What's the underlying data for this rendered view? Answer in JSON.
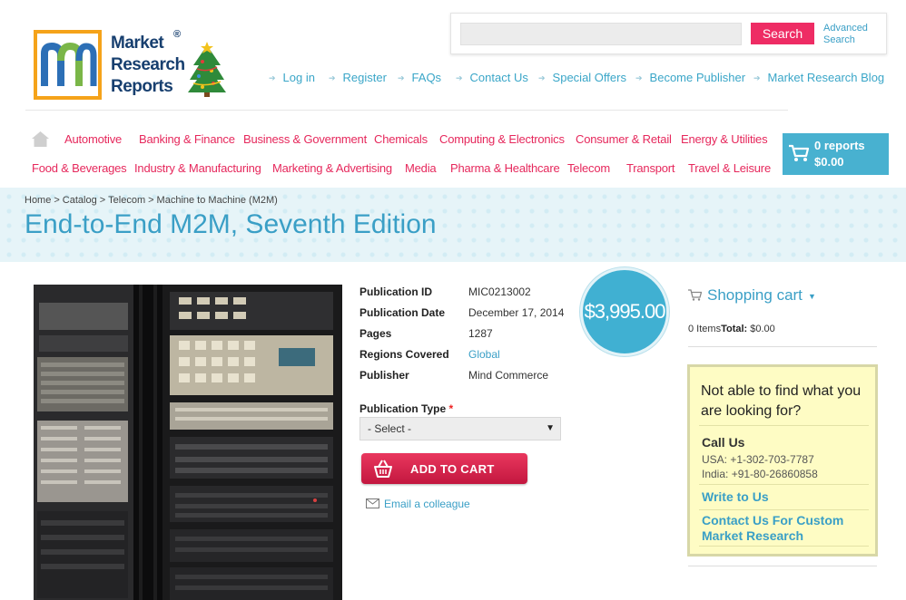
{
  "logo": {
    "line1": "Market",
    "line2": "Research",
    "line3": "Reports",
    "reg": "®",
    "mark": "m"
  },
  "search": {
    "placeholder": "",
    "button_label": "Search",
    "advanced_line1": "Advanced",
    "advanced_line2": "Search"
  },
  "top_links": [
    "Log in",
    "Register",
    "FAQs",
    "Contact Us",
    "Special Offers",
    "Become Publisher",
    "Market Research Blog"
  ],
  "categories_row1": [
    "Automotive",
    "Banking & Finance",
    "Business & Government",
    "Chemicals",
    "Computing & Electronics",
    "Consumer & Retail",
    "Energy & Utilities"
  ],
  "categories_row2": [
    "Food & Beverages",
    "Industry & Manufacturing",
    "Marketing & Advertising",
    "Media",
    "Pharma & Healthcare",
    "Telecom",
    "Transport",
    "Travel & Leisure"
  ],
  "cart": {
    "reports": "0 reports",
    "amount": "$0.00"
  },
  "breadcrumb": [
    "Home",
    "Catalog",
    "Telecom",
    "Machine to Machine (M2M)"
  ],
  "breadcrumb_sep": ">",
  "page_title": "End-to-End M2M, Seventh Edition",
  "details": {
    "publication_id_label": "Publication ID",
    "publication_id": "MIC0213002",
    "publication_date_label": "Publication Date",
    "publication_date": "December 17, 2014",
    "pages_label": "Pages",
    "pages": "1287",
    "regions_label": "Regions Covered",
    "regions": "Global",
    "publisher_label": "Publisher",
    "publisher": "Mind Commerce"
  },
  "price": "$3,995.00",
  "publication_type": {
    "label": "Publication Type",
    "required_mark": "*",
    "selected": "- Select -"
  },
  "add_to_cart_label": "ADD TO CART",
  "email_colleague_label": "Email a colleague",
  "shopping_cart": {
    "title": "Shopping cart",
    "items_text": "0 Items",
    "total_label": "Total:",
    "total_value": "$0.00"
  },
  "help": {
    "question": "Not able to find what you are looking for?",
    "call_us": "Call Us",
    "usa_phone": "USA: +1-302-703-7787",
    "india_phone": "India: +91-80-26860858",
    "write_to_us": "Write to Us",
    "custom_research": "Contact Us For Custom Market Research"
  },
  "colors": {
    "accent_blue": "#3a9fc6",
    "accent_pink": "#e6285c",
    "cart_blue": "#48b1d0",
    "logo_orange": "#f5a31a"
  }
}
